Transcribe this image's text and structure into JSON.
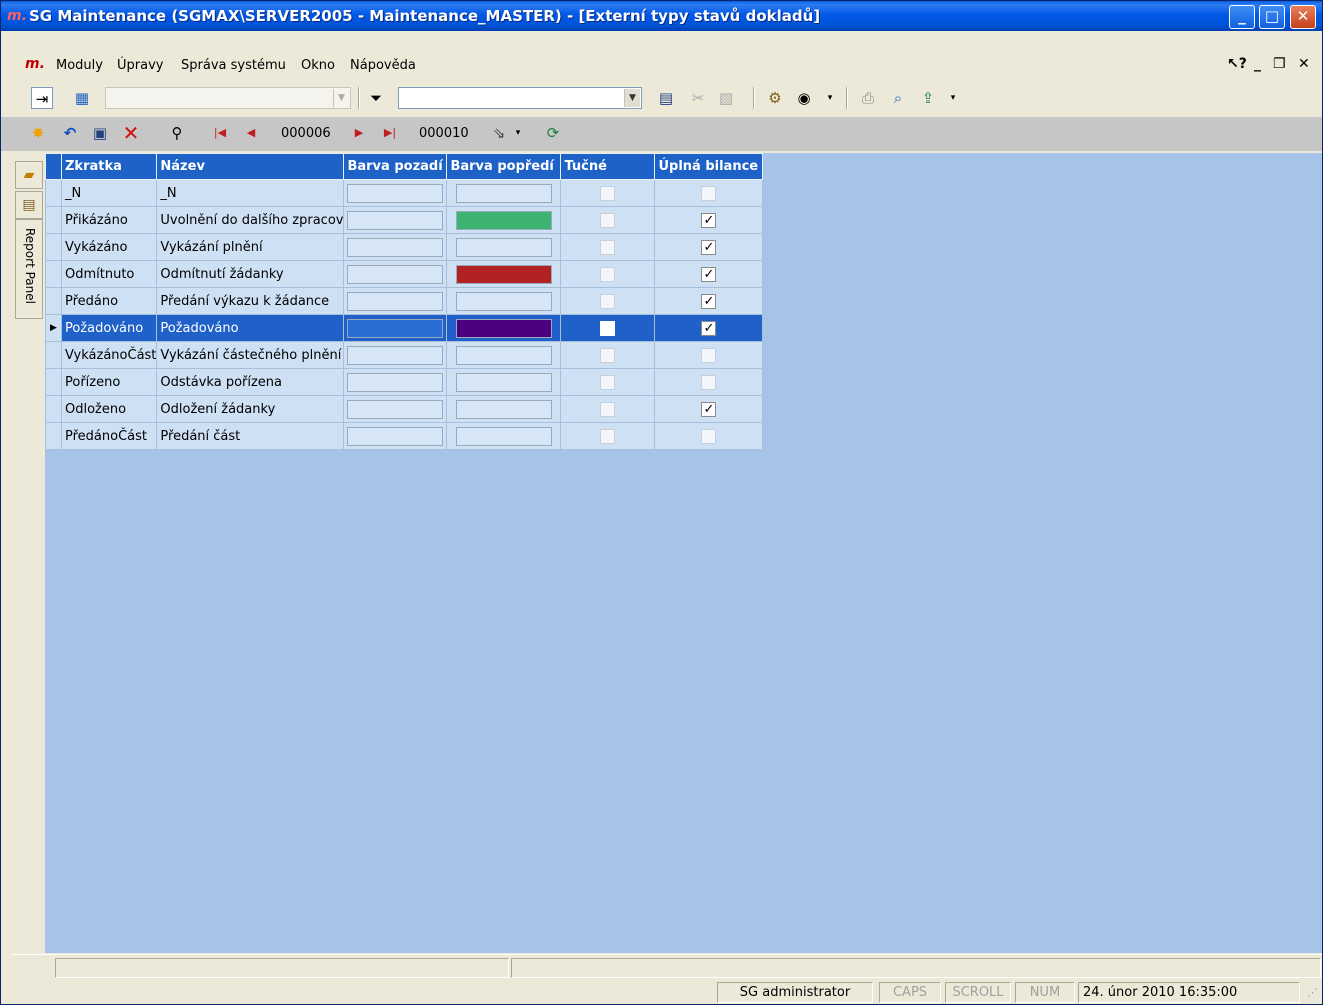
{
  "window": {
    "title": "SG Maintenance (SGMAX\\SERVER2005 - Maintenance_MASTER) - [Externí typy stavů dokladů]"
  },
  "menu": {
    "logo": "m.",
    "items": [
      "Moduly",
      "Úpravy",
      "Správa systému",
      "Okno",
      "Nápověda"
    ]
  },
  "navigator": {
    "current_record": "000006",
    "total_records": "000010"
  },
  "side_panel": {
    "report_tab_label": "Report Panel"
  },
  "grid": {
    "columns": [
      "Zkratka",
      "Název",
      "Barva pozadí",
      "Barva popředí",
      "Tučné",
      "Úplná bilance"
    ],
    "selected_row": 5,
    "rows": [
      {
        "zkratka": "_N",
        "nazev": "_N",
        "barva_pozadi": "",
        "barva_popredi": "",
        "tucne": false,
        "uplna_bilance": false,
        "enabled": false
      },
      {
        "zkratka": "Přikázáno",
        "nazev": "Uvolnění do dalšího zpracov",
        "barva_pozadi": "",
        "barva_popredi": "#3cb371",
        "tucne": false,
        "uplna_bilance": true,
        "enabled": true
      },
      {
        "zkratka": "Vykázáno",
        "nazev": "Vykázání plnění",
        "barva_pozadi": "",
        "barva_popredi": "",
        "tucne": false,
        "uplna_bilance": true,
        "enabled": true
      },
      {
        "zkratka": "Odmítnuto",
        "nazev": "Odmítnutí žádanky",
        "barva_pozadi": "",
        "barva_popredi": "#b22222",
        "tucne": false,
        "uplna_bilance": true,
        "enabled": true
      },
      {
        "zkratka": "Předáno",
        "nazev": "Předání výkazu k žádance",
        "barva_pozadi": "",
        "barva_popredi": "",
        "tucne": false,
        "uplna_bilance": true,
        "enabled": true
      },
      {
        "zkratka": "Požadováno",
        "nazev": "Požadováno",
        "barva_pozadi": "",
        "barva_popredi": "#4b0082",
        "tucne": false,
        "uplna_bilance": true,
        "enabled": true
      },
      {
        "zkratka": "VykázánoČást",
        "nazev": "Vykázání částečného plnění",
        "barva_pozadi": "",
        "barva_popredi": "",
        "tucne": false,
        "uplna_bilance": false,
        "enabled": false
      },
      {
        "zkratka": "Pořízeno",
        "nazev": "Odstávka pořízena",
        "barva_pozadi": "",
        "barva_popredi": "",
        "tucne": false,
        "uplna_bilance": false,
        "enabled": false
      },
      {
        "zkratka": "Odloženo",
        "nazev": "Odložení žádanky",
        "barva_pozadi": "",
        "barva_popredi": "",
        "tucne": false,
        "uplna_bilance": true,
        "enabled": true
      },
      {
        "zkratka": "PředánoČást",
        "nazev": "Předání část",
        "barva_pozadi": "",
        "barva_popredi": "",
        "tucne": false,
        "uplna_bilance": false,
        "enabled": false
      }
    ]
  },
  "status": {
    "user": "SG administrator",
    "caps": "CAPS",
    "scroll": "SCROLL",
    "num": "NUM",
    "datetime": "24. únor 2010 16:35:00"
  },
  "colors": {
    "title_bar": "#0054d8",
    "grid_header": "#1e62c8",
    "grid_row": "#cde0f4",
    "grid_background": "#a6c4e8",
    "selected_row": "#1f60c9"
  }
}
